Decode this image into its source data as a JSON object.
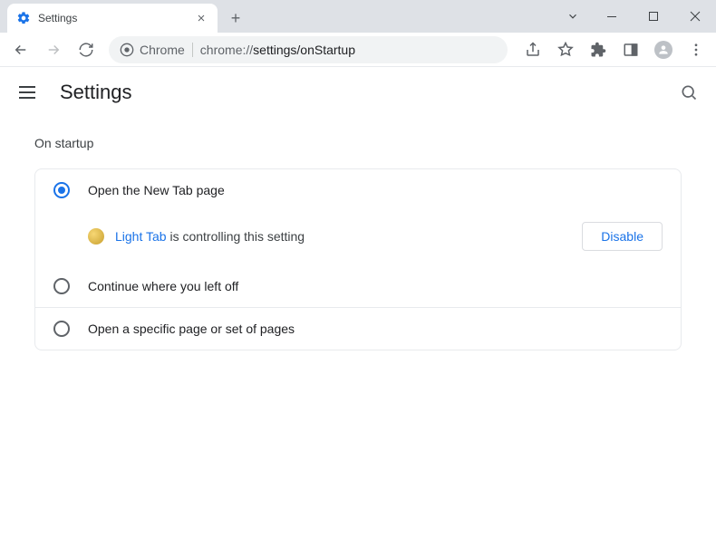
{
  "tab": {
    "title": "Settings"
  },
  "omnibox": {
    "secure_label": "Chrome",
    "url_prefix": "chrome://",
    "url_path": "settings/onStartup"
  },
  "header": {
    "title": "Settings"
  },
  "section": {
    "label": "On startup"
  },
  "options": {
    "new_tab": {
      "label": "Open the New Tab page"
    },
    "controlling": {
      "extension_name": "Light Tab",
      "suffix": " is controlling this setting",
      "disable_label": "Disable"
    },
    "continue": {
      "label": "Continue where you left off"
    },
    "specific": {
      "label": "Open a specific page or set of pages"
    }
  }
}
